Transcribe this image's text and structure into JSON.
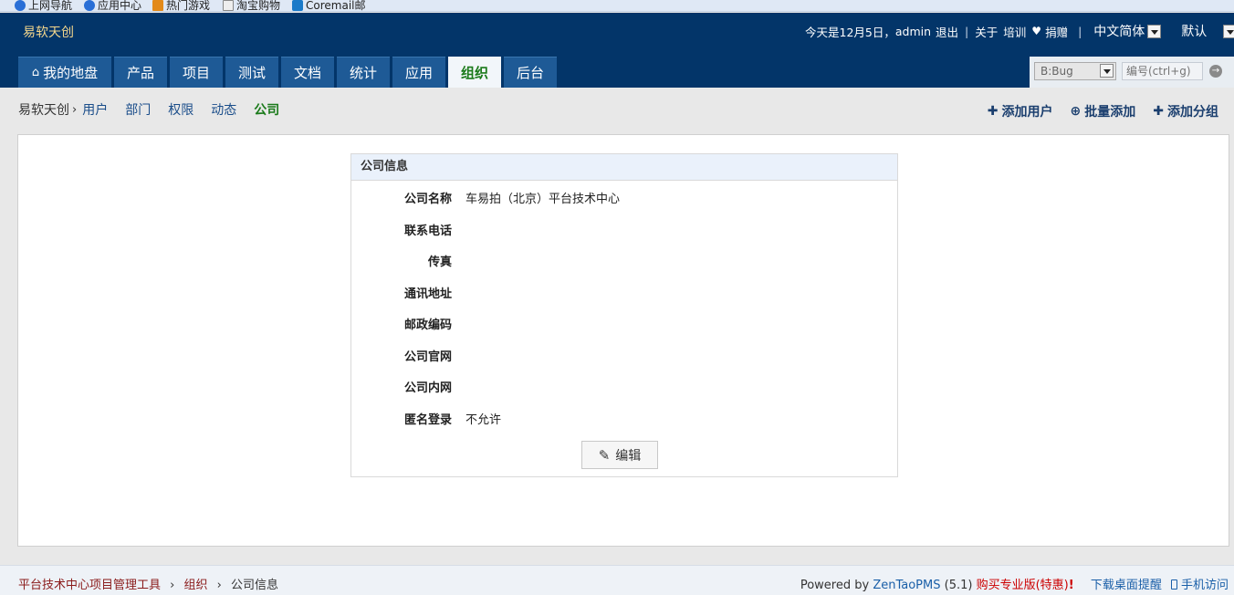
{
  "favorites": [
    "上网导航",
    "应用中心",
    "热门游戏",
    "淘宝购物",
    "Coremail邮"
  ],
  "header": {
    "brand": "易软天创",
    "date_text": "今天是12月5日，",
    "user": "admin",
    "logout": "退出",
    "about": "关于",
    "training": "培训",
    "donate": "捐赠",
    "language": "中文简体",
    "theme": "默认"
  },
  "tabs": [
    {
      "label": "我的地盘"
    },
    {
      "label": "产品"
    },
    {
      "label": "项目"
    },
    {
      "label": "测试"
    },
    {
      "label": "文档"
    },
    {
      "label": "统计"
    },
    {
      "label": "应用"
    },
    {
      "label": "组织"
    },
    {
      "label": "后台"
    }
  ],
  "search": {
    "type_value": "B:Bug",
    "placeholder": "编号(ctrl+g)"
  },
  "subnav": {
    "root": "易软天创",
    "items": [
      "用户",
      "部门",
      "权限",
      "动态",
      "公司"
    ],
    "actions": [
      "添加用户",
      "批量添加",
      "添加分组"
    ]
  },
  "company": {
    "title": "公司信息",
    "fields": [
      {
        "label": "公司名称",
        "value": "车易拍（北京）平台技术中心"
      },
      {
        "label": "联系电话",
        "value": ""
      },
      {
        "label": "传真",
        "value": ""
      },
      {
        "label": "通讯地址",
        "value": ""
      },
      {
        "label": "邮政编码",
        "value": ""
      },
      {
        "label": "公司官网",
        "value": ""
      },
      {
        "label": "公司内网",
        "value": ""
      },
      {
        "label": "匿名登录",
        "value": "不允许"
      }
    ],
    "edit_label": "编辑"
  },
  "footer": {
    "crumbs": [
      "平台技术中心项目管理工具",
      "组织",
      "公司信息"
    ],
    "powered_by": "Powered by",
    "product": "ZenTaoPMS",
    "version": "(5.1)",
    "buy": "购买专业版(特惠)",
    "buy_mark": "!",
    "desktop": "下载桌面提醒",
    "mobile": "手机访问"
  },
  "colors": {
    "header_bg": "#033569",
    "tab_bg": "#1e5a96",
    "active_green": "#1a7a1a"
  }
}
